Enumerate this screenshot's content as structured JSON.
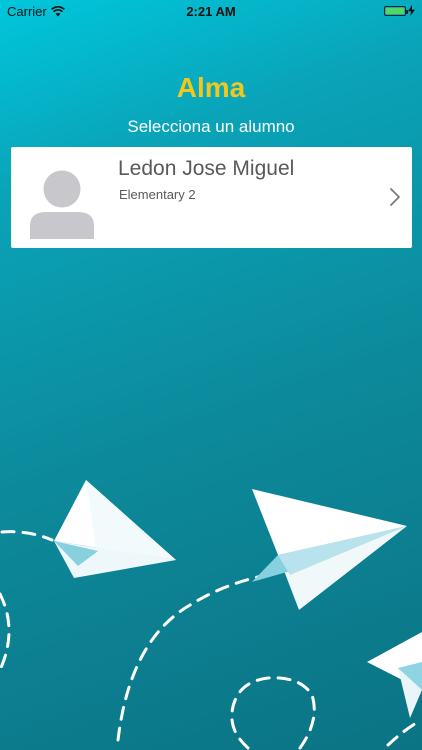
{
  "status_bar": {
    "carrier": "Carrier",
    "time": "2:21 AM",
    "battery_level": 1.0,
    "battery_color": "#4cd964"
  },
  "header": {
    "title": "Alma",
    "subtitle": "Selecciona un alumno"
  },
  "students": [
    {
      "name": "Ledon Jose Miguel",
      "grade": "Elementary 2"
    }
  ],
  "theme": {
    "background_top": "#00c7dc",
    "background_bottom": "#0b7384",
    "title_color": "#f3c81a"
  },
  "icons": {
    "avatar": "person-silhouette-icon",
    "disclosure": "chevron-right-icon",
    "wifi": "wifi-icon",
    "battery": "battery-icon",
    "charging": "charging-bolt-icon"
  }
}
